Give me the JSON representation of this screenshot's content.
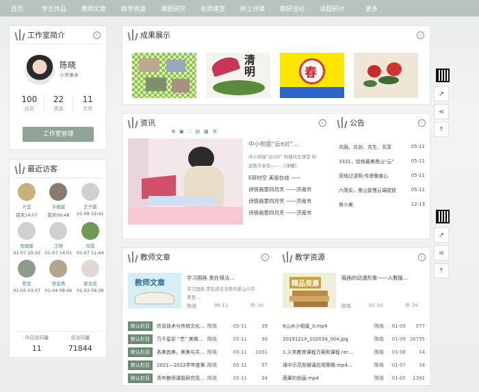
{
  "nav": [
    "首页",
    "学生作品",
    "教师文章",
    "教学资源",
    "课题研究",
    "名师课堂",
    "网上评课",
    "教研活动",
    "话题研讨",
    "更多"
  ],
  "intro": {
    "title": "工作室简介",
    "name": "陈晓",
    "role": "小学美术",
    "stats": [
      {
        "value": "100",
        "label": "成员"
      },
      {
        "value": "22",
        "label": "资源"
      },
      {
        "value": "11",
        "label": "文章"
      }
    ],
    "manage": "工作室管理"
  },
  "visitors": {
    "title": "最近访客",
    "items": [
      {
        "name": "亓莹",
        "time": "前天14:07"
      },
      {
        "name": "许媛媛",
        "time": "前天09:48"
      },
      {
        "name": "王子震",
        "time": "01-08 19:41"
      },
      {
        "name": "程媛媛",
        "time": "01-07 20:32"
      },
      {
        "name": "王丽",
        "time": "01-07 14:01"
      },
      {
        "name": "肖霞",
        "time": "01-07 11:44"
      },
      {
        "name": "陈莹",
        "time": "01-05 03:07"
      },
      {
        "name": "李金倩",
        "time": "01-04 08:46"
      },
      {
        "name": "夏文成",
        "time": "01-03 09:39"
      }
    ],
    "today_label": "今日访问量",
    "today_value": "11",
    "total_label": "总访问量",
    "total_value": "71844"
  },
  "achievements": {
    "title": "成果展示",
    "calligraphy": "清明",
    "spring": "春"
  },
  "news": {
    "title": "资讯",
    "headline": "中小衔接“云π对”…",
    "summary1": "中小衔接“云π对” 构建共生课堂 彰",
    "summary2": "显数字本色——…",
    "detail": "[详细]",
    "list": [
      "E研时空 美丽在线 ——",
      "诗情画意四月天 ——济南市",
      "诗情画意四月天 ——济南市",
      "诗情画意四月天 ——济南市"
    ]
  },
  "notice": {
    "title": "公告",
    "items": [
      {
        "text": "共融、共创、共生、共享",
        "date": "05-11"
      },
      {
        "text": "3331，绘就最美景山“云”",
        "date": "05-11"
      },
      {
        "text": "双线过清明 传承敬奋心",
        "date": "05-11"
      },
      {
        "text": "六落实，景山智慧云端绽放",
        "date": "05-11"
      },
      {
        "text": "景小美",
        "date": "12-13"
      }
    ]
  },
  "articles": {
    "title": "教师文章",
    "thumb_text": "教师文章",
    "feat_title": "学习国画 贵在得法…",
    "feat_desc1": "学习国画 贵在得法济南市景山小学",
    "feat_desc2": "美思…",
    "feat_author": "陈晓",
    "feat_date": "05-11",
    "feat_views": "20",
    "badge": "默认栏目",
    "list": [
      {
        "title": "信息技术与传统文化…",
        "author": "陈晓",
        "date": "05-11",
        "views": "39"
      },
      {
        "title": "万千星彩 “艺” 美微…",
        "author": "陈晓",
        "date": "05-11",
        "views": "30"
      },
      {
        "title": "各美其美，美美与共…",
        "author": "陈晓",
        "date": "05-11",
        "views": "1051"
      },
      {
        "title": "2021—2022学年度第…",
        "author": "陈晓",
        "date": "05-11",
        "views": "57"
      },
      {
        "title": "青年教师课题研究现…",
        "author": "陈晓",
        "date": "05-11",
        "views": "34"
      }
    ]
  },
  "resources": {
    "title": "教学资源",
    "thumb_text": "精品资源",
    "feat_title": "我画的动漫形象——人教版…",
    "feat_author": "陈晓",
    "feat_date": "01-10",
    "feat_views": "39",
    "list": [
      {
        "title": "6山水小相逢_0.mp4",
        "author": "陈晓",
        "date": "01-09",
        "views": "577"
      },
      {
        "title": "20191214_102034_004.jpg",
        "author": "陈晓",
        "date": "01-09",
        "views": "26755"
      },
      {
        "title": "1.义务教育课程方案和课程.rar…",
        "author": "陈晓",
        "date": "01-08",
        "views": "14"
      },
      {
        "title": "课中示范型微课应用策略.mp4…",
        "author": "陈晓",
        "date": "01-07",
        "views": "34"
      },
      {
        "title": "蔬果的创画.mp4",
        "author": "陈晓",
        "date": "01-05",
        "views": "1391"
      }
    ]
  }
}
